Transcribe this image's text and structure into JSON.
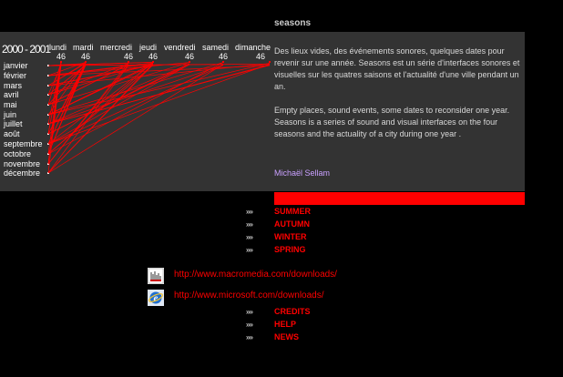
{
  "title": "seasons",
  "year_range": "2000 - 2001",
  "days": [
    "lundi",
    "mardi",
    "mercredi",
    "jeudi",
    "vendredi",
    "samedi",
    "dimanche"
  ],
  "week_number": "46",
  "months": [
    "janvier",
    "février",
    "mars",
    "avril",
    "mai",
    "juin",
    "juillet",
    "août",
    "septembre",
    "octobre",
    "novembre",
    "décembre"
  ],
  "description_fr": "Des lieux vides, des événements sonores, quelques dates pour revenir sur une année. Seasons est un série d'interfaces sonores et visuelles sur les quatres saisons et l'actualité d'une ville pendant un an.",
  "description_en": "Empty places, sound events, some dates to reconsider one year. Seasons is a series of sound and visual interfaces on the four seasons and the actuality of a city during one year .",
  "author": "Michaël Sellam",
  "arrow_glyph": "»»",
  "season_links": [
    "SUMMER",
    "AUTUMN",
    "WINTER",
    "SPRING"
  ],
  "downloads": [
    {
      "icon": "macromedia-shockwave-icon",
      "url": "http://www.macromedia.com/downloads/"
    },
    {
      "icon": "internet-explorer-icon",
      "url": "http://www.microsoft.com/downloads/"
    }
  ],
  "footer_links": [
    "CREDITS",
    "HELP",
    "NEWS"
  ],
  "colors": {
    "background": "#000000",
    "panel": "#333333",
    "accent": "#ff0000",
    "author": "#c9a0ff"
  }
}
